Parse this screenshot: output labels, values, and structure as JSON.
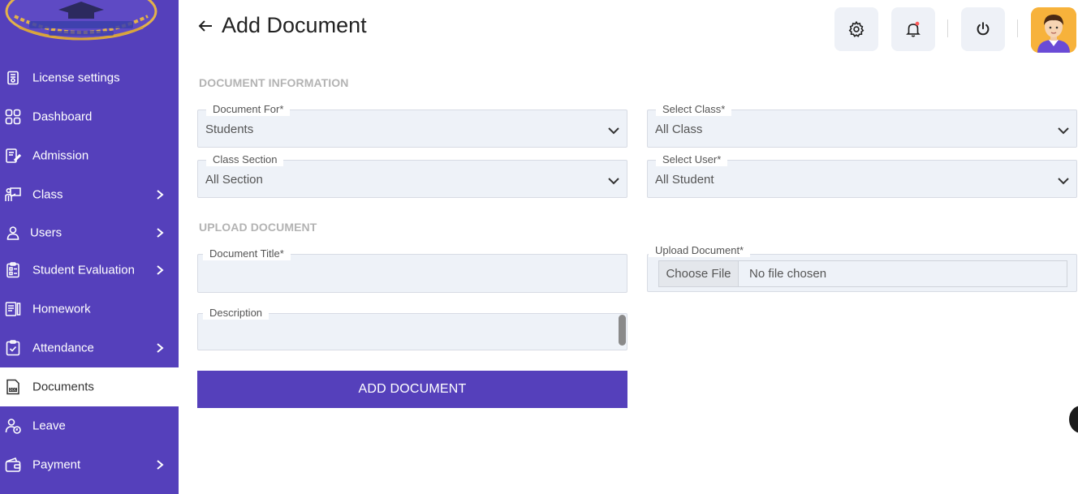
{
  "sidebar": {
    "items": [
      {
        "label": "License settings",
        "icon": "license-icon",
        "has_chevron": false
      },
      {
        "label": "Dashboard",
        "icon": "grid-icon",
        "has_chevron": false
      },
      {
        "label": "Admission",
        "icon": "edit-doc-icon",
        "has_chevron": false
      },
      {
        "label": "Class",
        "icon": "classroom-icon",
        "has_chevron": true
      },
      {
        "label": "Users",
        "icon": "user-icon",
        "has_chevron": true
      },
      {
        "label": "Student Evaluation",
        "icon": "evaluation-icon",
        "has_chevron": true
      },
      {
        "label": "Homework",
        "icon": "homework-icon",
        "has_chevron": false
      },
      {
        "label": "Attendance",
        "icon": "attendance-icon",
        "has_chevron": true
      },
      {
        "label": "Documents",
        "icon": "document-icon",
        "has_chevron": false,
        "active": true
      },
      {
        "label": "Leave",
        "icon": "leave-icon",
        "has_chevron": false
      },
      {
        "label": "Payment",
        "icon": "wallet-icon",
        "has_chevron": true
      }
    ]
  },
  "header": {
    "title": "Add Document"
  },
  "sections": {
    "doc_info": "DOCUMENT INFORMATION",
    "upload": "UPLOAD DOCUMENT"
  },
  "form": {
    "document_for": {
      "label": "Document For*",
      "value": "Students"
    },
    "select_class": {
      "label": "Select Class*",
      "value": "All Class"
    },
    "class_section": {
      "label": "Class Section",
      "value": "All Section"
    },
    "select_user": {
      "label": "Select User*",
      "value": "All Student"
    },
    "document_title": {
      "label": "Document Title*",
      "value": ""
    },
    "upload_document": {
      "label": "Upload Document*",
      "button": "Choose File",
      "status": "No file chosen"
    },
    "description": {
      "label": "Description",
      "value": ""
    },
    "submit": "ADD DOCUMENT"
  },
  "colors": {
    "sidebar_bg": "#5540bb",
    "accent": "#5540bb",
    "field_bg": "#eef2f8",
    "avatar_bg": "#f7b23b",
    "notification_dot": "#ff5a5a"
  }
}
